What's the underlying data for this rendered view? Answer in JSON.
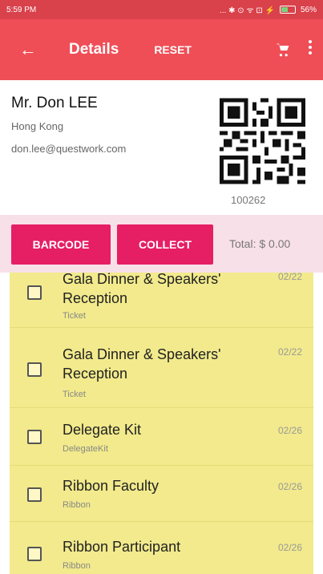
{
  "status": {
    "time": "5:59 PM",
    "icons_text": "... ✱ ⊙ ᯤ ⊡ ⚡",
    "battery": "56%"
  },
  "appbar": {
    "title": "Details",
    "reset_label": "RESET"
  },
  "profile": {
    "name": "Mr. Don LEE",
    "city": "Hong Kong",
    "email": "don.lee@questwork.com",
    "qr_number": "100262"
  },
  "actions": {
    "barcode_label": "BARCODE",
    "collect_label": "COLLECT",
    "total": "Total: $ 0.00"
  },
  "items": [
    {
      "title": "Gala Dinner & Speakers' Reception",
      "type": "Ticket",
      "date": "02/22"
    },
    {
      "title": "Gala Dinner & Speakers' Reception",
      "type": "Ticket",
      "date": "02/22"
    },
    {
      "title": "Delegate Kit",
      "type": "DelegateKit",
      "date": "02/26"
    },
    {
      "title": "Ribbon Faculty",
      "type": "Ribbon",
      "date": "02/26"
    },
    {
      "title": "Ribbon Participant",
      "type": "Ribbon",
      "date": "02/26"
    }
  ],
  "colors": {
    "accent": "#ef4e57",
    "button": "#e61e64",
    "list_bg": "#f2ea8c"
  },
  "icons": {
    "back": "arrow-left-icon",
    "cart": "cart-icon",
    "more": "more-vertical-icon"
  }
}
